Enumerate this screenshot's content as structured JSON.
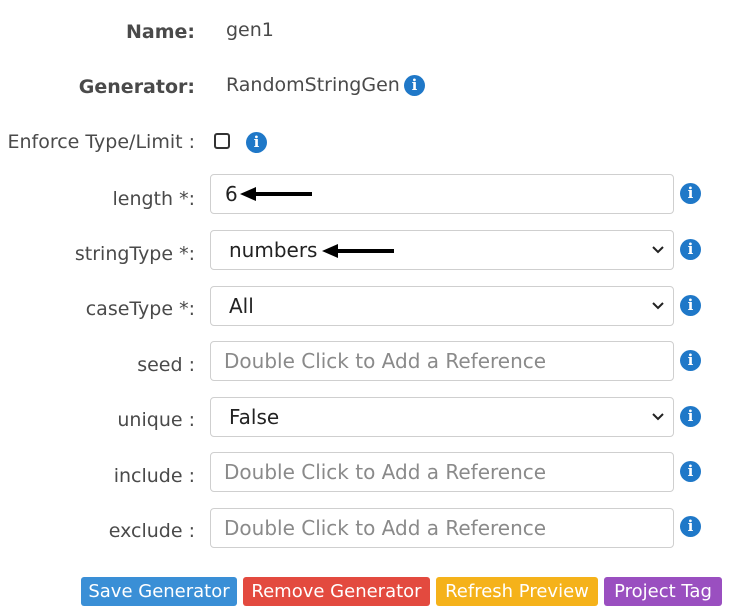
{
  "name": {
    "label": "Name:",
    "value": "gen1"
  },
  "generator": {
    "label": "Generator:",
    "value": "RandomStringGen"
  },
  "enforce": {
    "label": "Enforce Type/Limit :",
    "checked": false
  },
  "fields": {
    "length": {
      "label": "length *:",
      "value": "6"
    },
    "stringType": {
      "label": "stringType *:",
      "value": "numbers"
    },
    "caseType": {
      "label": "caseType *:",
      "value": "All"
    },
    "seed": {
      "label": "seed :",
      "placeholder": "Double Click to Add a Reference"
    },
    "unique": {
      "label": "unique :",
      "value": "False"
    },
    "include": {
      "label": "include :",
      "placeholder": "Double Click to Add a Reference"
    },
    "exclude": {
      "label": "exclude :",
      "placeholder": "Double Click to Add a Reference"
    }
  },
  "icons": {
    "info": "info-circle-icon",
    "chevron": "chevron-down-icon",
    "arrow": "arrow-left-icon"
  },
  "buttons": {
    "save": {
      "label": "Save Generator",
      "color": "#3a8fd6"
    },
    "remove": {
      "label": "Remove Generator",
      "color": "#e34a3f"
    },
    "refresh": {
      "label": "Refresh Preview",
      "color": "#f5b21a"
    },
    "tag": {
      "label": "Project Tag",
      "color": "#9a4fc0"
    }
  },
  "info_glyph": "i"
}
